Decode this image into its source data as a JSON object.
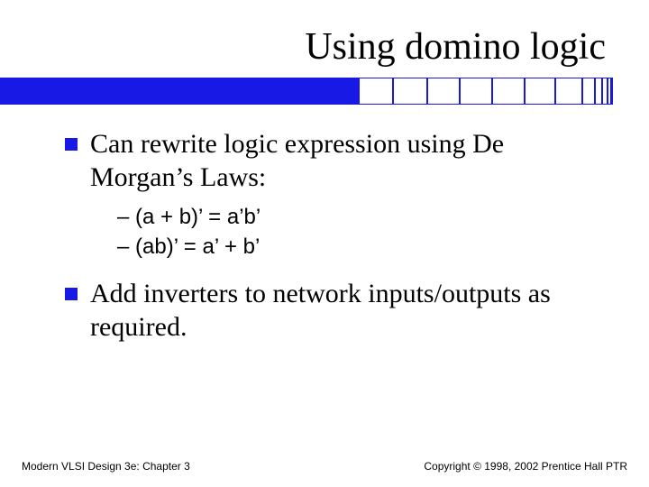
{
  "title": "Using domino logic",
  "bullets": [
    {
      "text": "Can rewrite logic expression using De Morgan’s Laws:",
      "sub": [
        "– (a + b)’ = a’b’",
        "– (ab)’ = a’ + b’"
      ]
    },
    {
      "text": "Add inverters to network inputs/outputs as required.",
      "sub": []
    }
  ],
  "footer": {
    "left": "Modern VLSI Design 3e: Chapter 3",
    "right": "Copyright © 1998, 2002 Prentice Hall PTR"
  },
  "decor_box_widths": [
    38,
    38,
    36,
    36,
    36,
    34,
    30,
    14,
    8,
    6,
    4,
    2
  ]
}
